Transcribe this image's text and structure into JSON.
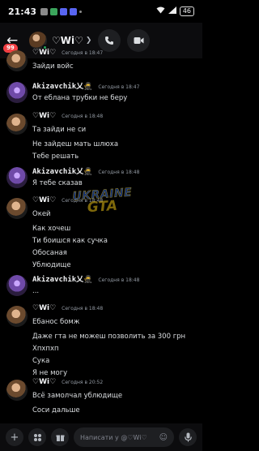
{
  "status_bar": {
    "time": "21:43",
    "battery": "46"
  },
  "header": {
    "unread_badge": "99",
    "title": "♡Wi♡",
    "call_icon": "phone-icon",
    "video_icon": "video-icon"
  },
  "messages": [
    {
      "author": "♡Wi♡",
      "time": "Сегодня в 18:47",
      "lines": [
        "Зайди войс"
      ]
    },
    {
      "author": "Akizavchik乂🥷",
      "time": "Сегодня в 18:47",
      "lines": [
        "От еблана трубки не беру"
      ]
    },
    {
      "author": "♡Wi♡",
      "time": "Сегодня в 18:48",
      "lines": [
        "Та зайди не си",
        "Не зайдеш мать шлюха",
        "Тебе решать"
      ]
    },
    {
      "author": "Akizavchik乂🥷",
      "time": "Сегодня в 18:48",
      "lines": [
        "Я тебе сказав"
      ]
    },
    {
      "author": "♡Wi♡",
      "time": "Сегодня в 18:48",
      "lines": [
        "Окей",
        "Как хочеш",
        "Ти боишся как сучка",
        "Обосаная",
        "Ублюдище"
      ]
    },
    {
      "author": "Akizavchik乂🥷",
      "time": "Сегодня в 18:48",
      "lines": [
        "..."
      ]
    },
    {
      "author": "♡Wi♡",
      "time": "Сегодня в 18:48",
      "lines": [
        "Ебанос бомж",
        "Даже гта не можеш позволить за 300 грн",
        "Хпхпхп",
        "Сука",
        "Я не могу"
      ]
    },
    {
      "author": "♡Wi♡",
      "time": "Сегодня в 20:52",
      "lines": [
        "Всё замолчал ублюдище",
        "Соси дальше"
      ]
    }
  ],
  "watermark": {
    "line1": "UKRAINE",
    "line2": "GTA"
  },
  "composer": {
    "placeholder": "Написати у @♡Wi♡"
  }
}
